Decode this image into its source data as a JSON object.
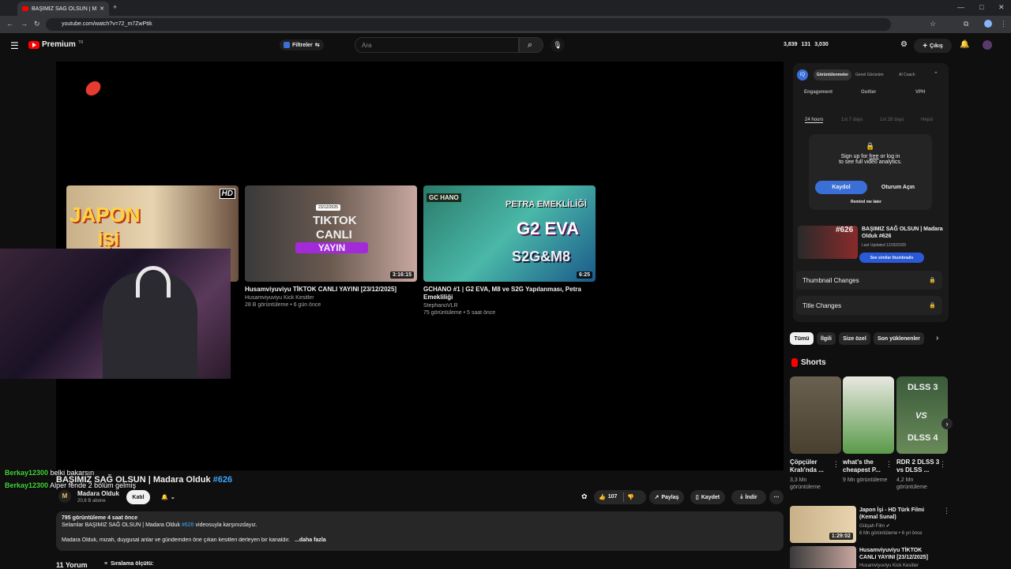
{
  "browser": {
    "tab_title": "BAŞIMIZ SAĞ OLSUN | Madara",
    "url": "youtube.com/watch?v=72_m7ZwPttk"
  },
  "header": {
    "logo": "Premium",
    "region": "TR",
    "filter": "Filtreler",
    "search_placeholder": "Ara",
    "stat1": "3,839",
    "stat2": "131",
    "stat3": "3,030",
    "exit": "Çıkış"
  },
  "cards": [
    {
      "title": "",
      "channel": "",
      "meta": "",
      "duration": ""
    },
    {
      "title": "Husamviyuviyu TİKTOK CANLI YAYINI [23/12/2025]",
      "channel": "Husamviyuviyu Kick Kesitler",
      "meta": "28 B görüntüleme • 6 gün önce",
      "duration": "3:16:15",
      "thumb_text1": "TIKTOK",
      "thumb_text2": "CANLI",
      "thumb_text3": "YAYIN",
      "thumb_date": "23/12/2025"
    },
    {
      "title": "GCHANO #1 | G2 EVA, M8 ve S2G Yapılanması, Petra Emekliliği",
      "channel": "StephanoVLR",
      "meta": "75 görüntüleme • 5 saat önce",
      "duration": "6:25",
      "thumb_text1": "PETRA EMEKLİLİĞİ",
      "thumb_text2": "G2 EVA",
      "thumb_text3": "S2G&M8",
      "thumb_tag": "GC HANO"
    }
  ],
  "card0": {
    "thumb_text1": "JAPON",
    "thumb_text2": "İŞİ",
    "hd": "HD"
  },
  "chat": [
    {
      "user": "Berkay12300",
      "msg": "belki bakarsın"
    },
    {
      "user": "Berkay12300",
      "msg": "Alper fende 2 bölüm gelmiş"
    }
  ],
  "video": {
    "title": "BAŞIMIZ SAĞ OLSUN | Madara Olduk",
    "tag": "#626",
    "channel": "Madara Olduk",
    "subs": "20,6 B abone",
    "join": "Katıl",
    "likes": "107",
    "share": "Paylaş",
    "save": "Kaydet",
    "download": "İndir"
  },
  "desc": {
    "line1": "795 görüntüleme  4 saat önce",
    "line2": "Selamlar BAŞIMIZ SAĞ OLSUN | Madara Olduk",
    "line2_tag": "#626",
    "line2_end": "videosuyla karşınızdayız.",
    "line3": "Madara Olduk, mizah, duygusal anlar ve gündemden öne çıkan kesitleri derleyen bir kanaldır.",
    "more": "...daha fazla"
  },
  "comments": {
    "count": "11 Yorum",
    "sort": "Sıralama ölçütü:"
  },
  "panel": {
    "tabs": [
      "Görüntülenmeler",
      "Genel Görünüm",
      "AI Coach"
    ],
    "metrics": [
      "Engagement",
      "Outlier",
      "VPH"
    ],
    "ranges": [
      "24 hours",
      "1st 7 days",
      "1st 28 days",
      "Hepsi"
    ],
    "signup": "Sign up for",
    "free": "free",
    "login": "or log in",
    "full": "to see full video analytics.",
    "btn1": "Kaydol",
    "btn2": "Oturum Açın",
    "remind": "Remind me later",
    "vid_title": "BAŞIMIZ SAĞ OLSUN | Madara Olduk #626",
    "updated": "Last Updated 12/30/2025",
    "similar": "See similar thumbnails",
    "thumb_changes": "Thumbnail Changes",
    "title_changes": "Title Changes",
    "badge": "#626"
  },
  "chips": [
    "Tümü",
    "İlgili",
    "Size özel",
    "Son yüklenenler"
  ],
  "shorts": {
    "heading": "Shorts",
    "items": [
      {
        "title": "Çöpçüler Kralı'nda ...",
        "views": "3,3 Mn görüntüleme"
      },
      {
        "title": "what's the cheapest P...",
        "views": "9 Mn görüntüleme"
      },
      {
        "title": "RDR 2 DLSS 3 vs DLSS ...",
        "views": "4,2 Mn görüntüleme"
      }
    ],
    "dlss_top": "DLSS 3",
    "dlss_vs": "VS",
    "dlss_bottom": "DLSS 4"
  },
  "recs": [
    {
      "title": "Japon İşi - HD Türk Filmi (Kemal Sunal)",
      "channel": "Gülşah Film",
      "meta": "6 Mn görüntüleme • 6 yıl önce",
      "duration": "1:29:02"
    },
    {
      "title": "Husamviyuviyu TİKTOK CANLI YAYINI [23/12/2025]",
      "channel": "Husamviyuviyu Kick Kesitler",
      "meta": "",
      "duration": ""
    }
  ]
}
